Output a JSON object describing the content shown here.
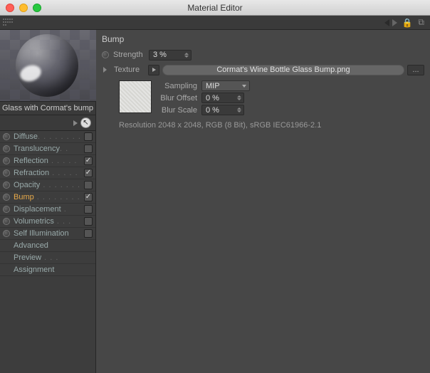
{
  "window": {
    "title": "Material Editor"
  },
  "material": {
    "name": "Glass with Cormat's bump"
  },
  "channels": [
    {
      "label": "Diffuse",
      "dots": ". . . . . . . . .",
      "checkbox": true,
      "checked": false,
      "radio": true,
      "active": false
    },
    {
      "label": "Translucency",
      "dots": ". .",
      "checkbox": true,
      "checked": false,
      "radio": true,
      "active": false
    },
    {
      "label": "Reflection",
      "dots": " . . . . .",
      "checkbox": true,
      "checked": true,
      "radio": true,
      "active": false
    },
    {
      "label": "Refraction",
      "dots": " . . . . .",
      "checkbox": true,
      "checked": true,
      "radio": true,
      "active": false
    },
    {
      "label": "Opacity",
      "dots": " . . . . . . . .",
      "checkbox": true,
      "checked": false,
      "radio": true,
      "active": false
    },
    {
      "label": "Bump",
      "dots": " . . . . . . . . .",
      "checkbox": true,
      "checked": true,
      "radio": true,
      "active": true
    },
    {
      "label": "Displacement",
      "dots": " .",
      "checkbox": true,
      "checked": false,
      "radio": true,
      "active": false
    },
    {
      "label": "Volumetrics",
      "dots": " . . .",
      "checkbox": true,
      "checked": false,
      "radio": true,
      "active": false
    },
    {
      "label": "Self Illumination",
      "dots": "",
      "checkbox": true,
      "checked": false,
      "radio": true,
      "active": false
    },
    {
      "label": "Advanced",
      "dots": "",
      "checkbox": false,
      "checked": false,
      "radio": false,
      "active": false
    },
    {
      "label": "Preview",
      "dots": " . . .",
      "checkbox": false,
      "checked": false,
      "radio": false,
      "active": false
    },
    {
      "label": "Assignment",
      "dots": "",
      "checkbox": false,
      "checked": false,
      "radio": false,
      "active": false
    }
  ],
  "panel": {
    "heading": "Bump",
    "strength": {
      "label": "Strength",
      "value": "3 %"
    },
    "texture": {
      "label": "Texture",
      "file": "Cormat's Wine Bottle Glass Bump.png",
      "browse": "...",
      "sampling": {
        "label": "Sampling",
        "value": "MIP"
      },
      "blur_offset": {
        "label": "Blur Offset",
        "value": "0 %"
      },
      "blur_scale": {
        "label": "Blur Scale",
        "value": "0 %"
      },
      "resolution": "Resolution 2048 x 2048, RGB (8 Bit), sRGB IEC61966-2.1"
    }
  }
}
